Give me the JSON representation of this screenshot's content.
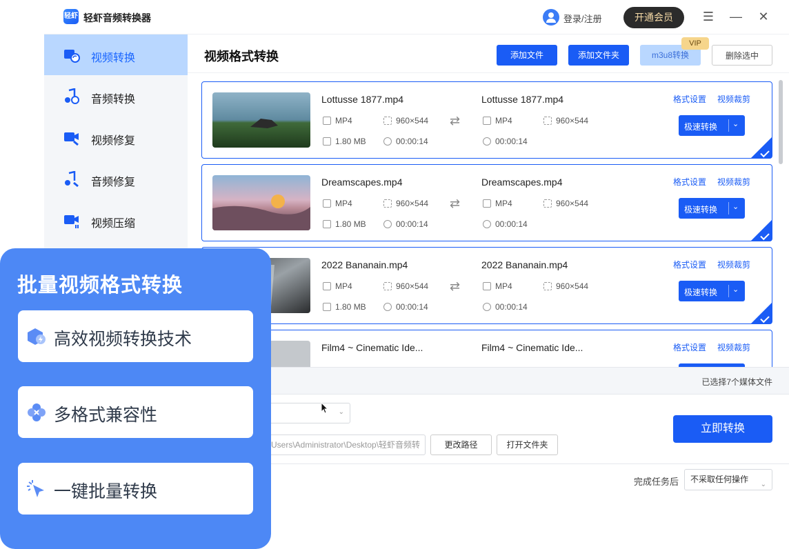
{
  "app": {
    "name": "轻虾音频转换器",
    "logo_text": "轻虾"
  },
  "header": {
    "login_label": "登录/注册",
    "vip_label": "开通会员",
    "menu_icon": "☰",
    "minimize_icon": "—",
    "close_icon": "✕"
  },
  "sidebar": {
    "items": [
      {
        "label": "视频转换",
        "icon": "video-convert-icon"
      },
      {
        "label": "音频转换",
        "icon": "audio-convert-icon"
      },
      {
        "label": "视频修复",
        "icon": "video-repair-icon"
      },
      {
        "label": "音频修复",
        "icon": "audio-repair-icon"
      },
      {
        "label": "视频压缩",
        "icon": "video-compress-icon"
      }
    ]
  },
  "main": {
    "title": "视频格式转换",
    "add_file": "添加文件",
    "add_folder": "添加文件夹",
    "m3u8": "m3u8转换",
    "vip_tag": "VIP",
    "delete_selected": "删除选中"
  },
  "files": [
    {
      "name": "Lottusse 1877.mp4",
      "out_name": "Lottusse 1877.mp4",
      "format": "MP4",
      "out_format": "MP4",
      "resolution": "960×544",
      "out_resolution": "960×544",
      "size": "1.80 MB",
      "duration": "00:00:14",
      "out_duration": "00:00:14",
      "format_setting": "格式设置",
      "crop": "视频裁剪",
      "convert": "极速转换"
    },
    {
      "name": "Dreamscapes.mp4",
      "out_name": "Dreamscapes.mp4",
      "format": "MP4",
      "out_format": "MP4",
      "resolution": "960×544",
      "out_resolution": "960×544",
      "size": "1.80 MB",
      "duration": "00:00:14",
      "out_duration": "00:00:14",
      "format_setting": "格式设置",
      "crop": "视频裁剪",
      "convert": "极速转换"
    },
    {
      "name": "2022 Bananain.mp4",
      "out_name": "2022 Bananain.mp4",
      "format": "MP4",
      "out_format": "MP4",
      "resolution": "960×544",
      "out_resolution": "960×544",
      "size": "1.80 MB",
      "duration": "00:00:14",
      "out_duration": "00:00:14",
      "format_setting": "格式设置",
      "crop": "视频裁剪",
      "convert": "极速转换"
    },
    {
      "name": "Film4 ~ Cinematic Ide...",
      "out_name": "Film4 ~ Cinematic Ide...",
      "format_setting": "格式设置",
      "crop": "视频裁剪"
    }
  ],
  "status": {
    "selected_text": "已选择7个媒体文件"
  },
  "output": {
    "path": "Users\\Administrator\\Desktop\\轻虾音频转",
    "change_path": "更改路径",
    "open_folder": "打开文件夹",
    "convert_now": "立即转换",
    "after_label": "完成任务后",
    "after_value": "不采取任何操作"
  },
  "promo": {
    "title": "批量视频格式转换",
    "features": [
      {
        "label": "高效视频转换技术",
        "icon": "hexagon-lightning-icon"
      },
      {
        "label": "多格式兼容性",
        "icon": "clover-icon"
      },
      {
        "label": "一键批量转换",
        "icon": "click-cursor-icon"
      }
    ]
  },
  "colors": {
    "accent": "#1a5cf5",
    "sidebar_active": "#b9d7ff",
    "promo_bg": "#4d88f5"
  }
}
